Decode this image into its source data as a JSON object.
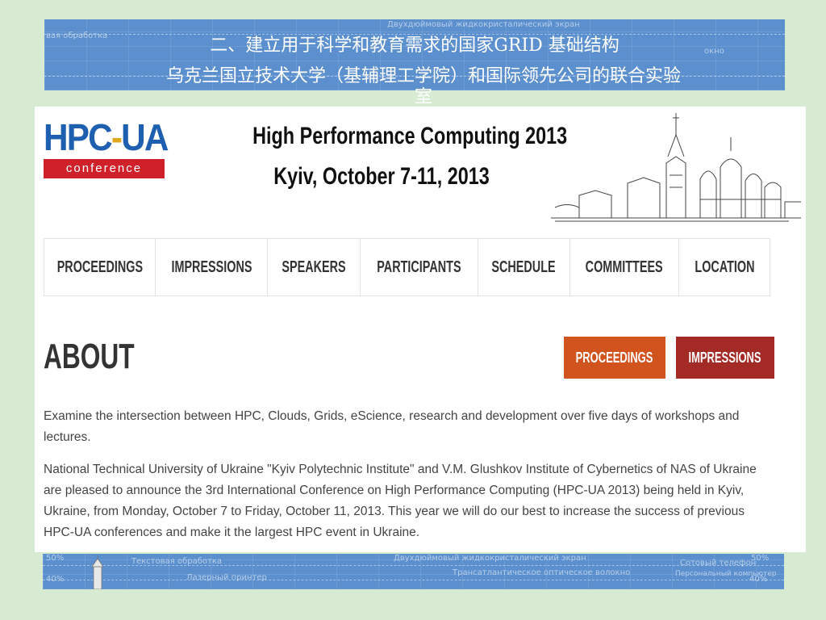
{
  "slide": {
    "title_line1": "二、建立用于科学和教育需求的国家GRID 基础结构",
    "title_line2": "乌克兰国立技术大学（基辅理工学院）和国际领先公司的联合实验",
    "title_line2_tail": "室"
  },
  "banner_bg_text": {
    "top_left": "вая обработка",
    "top_center": "Двухдюймовый жидкокристалический экран",
    "top_right": "окно",
    "bottom_left_a": "50%",
    "bottom_left_b": "40%",
    "bottom_1": "Текстовая обработка",
    "bottom_2": "Лазерный принтер",
    "bottom_3": "Двухдюймовый жидкокристалический экран",
    "bottom_4": "Трансатлантическое оптическое волокно",
    "bottom_5": "Сотовый телефон",
    "bottom_6": "Персональный компьютер",
    "bottom_right_a": "50%",
    "bottom_right_b": "40%"
  },
  "website": {
    "logo_main_a": "HPC",
    "logo_main_dash": "-",
    "logo_main_b": "UA",
    "logo_sub": "conference",
    "header_line1": "High Performance Computing 2013",
    "header_line2": "Kyiv, October 7-11, 2013",
    "nav": [
      {
        "label": "PROCEEDINGS"
      },
      {
        "label": "IMPRESSIONS"
      },
      {
        "label": "SPEAKERS"
      },
      {
        "label": "PARTICIPANTS"
      },
      {
        "label": "SCHEDULE"
      },
      {
        "label": "COMMITTEES"
      },
      {
        "label": "LOCATION"
      }
    ],
    "section_title": "ABOUT",
    "btn_proceedings": "PROCEEDINGS",
    "btn_impressions": "IMPRESSIONS",
    "paragraph1": "Examine the intersection between HPC, Clouds, Grids, eScience, research and development over five days of workshops and lectures.",
    "paragraph2": "National Technical University of Ukraine \"Kyiv Polytechnic Institute\" and V.M. Glushkov Institute of Cybernetics of NAS of Ukraine are pleased to announce the 3rd International Conference on High Performance Computing (HPC-UA 2013) being held in Kyiv, Ukraine, from Monday, October 7 to Friday, October 11, 2013. This year we will do our best to increase the success of previous HPC-UA conferences and make it the largest HPC event in Ukraine."
  },
  "colors": {
    "slide_bg": "#d6ebd2",
    "banner": "#5b8fcd",
    "logo_blue": "#1e5fb0",
    "logo_red": "#d0212a",
    "btn_orange": "#d1531e",
    "btn_red": "#a42a26"
  }
}
